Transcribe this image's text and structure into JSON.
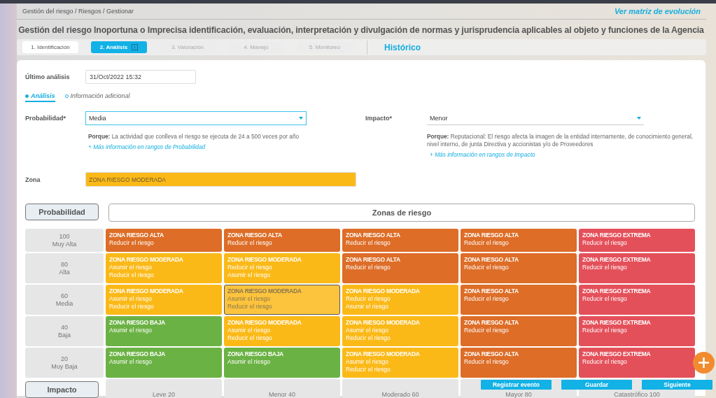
{
  "breadcrumb": "Gestión del riesgo / Riesgos / Gestionar",
  "evolution_link": "Ver matriz de evolución",
  "title": "Gestión del riesgo Inoportuna o Imprecisa identificación, evaluación, interpretación y divulgación de normas y jurisprudencia aplicables al objeto y funciones de la Agencia",
  "steps": [
    {
      "label": "1. Identificación",
      "selected": false,
      "disabled": false
    },
    {
      "label": "2. Análisis",
      "selected": true,
      "disabled": false
    },
    {
      "label": "3. Valoración",
      "selected": false,
      "disabled": true
    },
    {
      "label": "4. Manejo",
      "selected": false,
      "disabled": true
    },
    {
      "label": "5. Monitoreo",
      "selected": false,
      "disabled": true
    }
  ],
  "history_link": "Histórico",
  "last_analysis": {
    "label": "Último análisis",
    "value": "31/Oct/2022 15:32"
  },
  "sub_tabs": [
    {
      "label": "Análisis",
      "selected": true
    },
    {
      "label": "Información adicional",
      "selected": false
    }
  ],
  "probability": {
    "label": "Probabilidad*",
    "value": "Media",
    "focused": true,
    "reason": "**Porque:** La actividad que conlleva el riesgo se ejecuta de 24 a 500 veces por año",
    "more_link": "+ Más información en rangos de Probabilidad"
  },
  "impact": {
    "label": "Impacto*",
    "value": "Menor",
    "focused": false,
    "reason": "**Porque:** Reputacional: El riesgo afecta la imagen de la entidad internamente, de conocimiento general, nivel interno, de junta Directiva y accionistas y/o de Proveedores",
    "more_link": "+ Más información en rangos de Impacto"
  },
  "zone": {
    "label": "Zona",
    "value": "ZONA RIESGO MODERADA",
    "color": "#fbb918"
  },
  "matrix": {
    "probability_header": "Probabilidad",
    "zones_header": "Zonas de riesgo",
    "impact_header": "Impacto",
    "rows": [
      {
        "value": "100",
        "name": "Muy Alta",
        "cells": [
          {
            "zone": "ZONA RIESGO ALTA",
            "actions": [
              "Reducir el riesgo"
            ],
            "color": "#dd6d27",
            "selected": false
          },
          {
            "zone": "ZONA RIESGO ALTA",
            "actions": [
              "Reducir el riesgo"
            ],
            "color": "#dd6d27",
            "selected": false
          },
          {
            "zone": "ZONA RIESGO ALTA",
            "actions": [
              "Reducir el riesgo"
            ],
            "color": "#dd6d27",
            "selected": false
          },
          {
            "zone": "ZONA RIESGO ALTA",
            "actions": [
              "Reducir el riesgo"
            ],
            "color": "#dd6d27",
            "selected": false
          },
          {
            "zone": "ZONA RIESGO EXTREMA",
            "actions": [
              "Reducir el riesgo"
            ],
            "color": "#e4505a",
            "selected": false
          }
        ]
      },
      {
        "value": "80",
        "name": "Alta",
        "cells": [
          {
            "zone": "ZONA RIESGO MODERADA",
            "actions": [
              "Asumir el riesgo",
              "Reducir el riesgo"
            ],
            "color": "#fbb918",
            "selected": false
          },
          {
            "zone": "ZONA RIESGO MODERADA",
            "actions": [
              "Reducir el riesgo",
              "Asumir el riesgo"
            ],
            "color": "#fbb918",
            "selected": false
          },
          {
            "zone": "ZONA RIESGO ALTA",
            "actions": [
              "Reducir el riesgo"
            ],
            "color": "#dd6d27",
            "selected": false
          },
          {
            "zone": "ZONA RIESGO ALTA",
            "actions": [
              "Reducir el riesgo"
            ],
            "color": "#dd6d27",
            "selected": false
          },
          {
            "zone": "ZONA RIESGO EXTREMA",
            "actions": [
              "Reducir el riesgo"
            ],
            "color": "#e4505a",
            "selected": false
          }
        ]
      },
      {
        "value": "60",
        "name": "Media",
        "cells": [
          {
            "zone": "ZONA RIESGO MODERADA",
            "actions": [
              "Asumir el riesgo",
              "Reducir el riesgo"
            ],
            "color": "#fbb918",
            "selected": false
          },
          {
            "zone": "ZONA RIESGO MODERADA",
            "actions": [
              "Asumir el riesgo",
              "Reducir el riesgo"
            ],
            "color": "#fcc43c",
            "selected": true
          },
          {
            "zone": "ZONA RIESGO MODERADA",
            "actions": [
              "Reducir el riesgo",
              "Asumir el riesgo"
            ],
            "color": "#fbb918",
            "selected": false
          },
          {
            "zone": "ZONA RIESGO ALTA",
            "actions": [
              "Reducir el riesgo"
            ],
            "color": "#dd6d27",
            "selected": false
          },
          {
            "zone": "ZONA RIESGO EXTREMA",
            "actions": [
              "Reducir el riesgo"
            ],
            "color": "#e4505a",
            "selected": false
          }
        ]
      },
      {
        "value": "40",
        "name": "Baja",
        "cells": [
          {
            "zone": "ZONA RIESGO BAJA",
            "actions": [
              "Asumir el riesgo"
            ],
            "color": "#6bb244",
            "selected": false
          },
          {
            "zone": "ZONA RIESGO MODERADA",
            "actions": [
              "Asumir el riesgo",
              "Reducir el riesgo"
            ],
            "color": "#fbb918",
            "selected": false
          },
          {
            "zone": "ZONA RIESGO MODERADA",
            "actions": [
              "Asumir el riesgo",
              "Reducir el riesgo"
            ],
            "color": "#fbb918",
            "selected": false
          },
          {
            "zone": "ZONA RIESGO ALTA",
            "actions": [
              "Reducir el riesgo"
            ],
            "color": "#dd6d27",
            "selected": false
          },
          {
            "zone": "ZONA RIESGO EXTREMA",
            "actions": [
              "Reducir el riesgo"
            ],
            "color": "#e4505a",
            "selected": false
          }
        ]
      },
      {
        "value": "20",
        "name": "Muy Baja",
        "cells": [
          {
            "zone": "ZONA RIESGO BAJA",
            "actions": [
              "Asumir el riesgo"
            ],
            "color": "#6bb244",
            "selected": false
          },
          {
            "zone": "ZONA RIESGO BAJA",
            "actions": [
              "Asumir el riesgo"
            ],
            "color": "#6bb244",
            "selected": false
          },
          {
            "zone": "ZONA RIESGO MODERADA",
            "actions": [
              "Asumir el riesgo",
              "Reducir el riesgo"
            ],
            "color": "#fbb918",
            "selected": false
          },
          {
            "zone": "ZONA RIESGO ALTA",
            "actions": [
              "Reducir el riesgo"
            ],
            "color": "#dd6d27",
            "selected": false
          },
          {
            "zone": "ZONA RIESGO EXTREMA",
            "actions": [
              "Reducir el riesgo"
            ],
            "color": "#e4505a",
            "selected": false
          }
        ]
      }
    ],
    "impact_columns": [
      "Leve 20",
      "Menor 40",
      "Moderado 60",
      "Mayor 80",
      "Catastrófico 100"
    ]
  },
  "actions": [
    "Registrar evento",
    "Guardar",
    "Siguiente"
  ]
}
